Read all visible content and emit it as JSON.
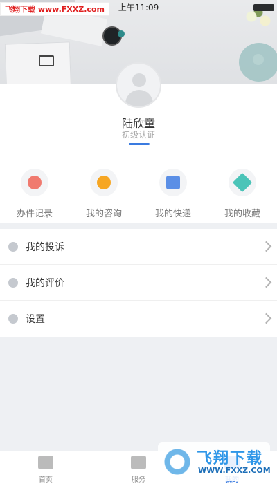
{
  "status_bar": {
    "time": "上午11:09"
  },
  "watermark": {
    "top_text": "飞翔下载 www.FXXZ.com",
    "bottom_title": "飞翔下载",
    "bottom_url": "WWW.FXXZ.COM"
  },
  "profile": {
    "name": "陆欣童",
    "level": "初级认证"
  },
  "quick_actions": [
    {
      "label": "办件记录",
      "icon": "clock-icon",
      "color": "#f07a6f"
    },
    {
      "label": "我的咨询",
      "icon": "chat-icon",
      "color": "#f6a623"
    },
    {
      "label": "我的快递",
      "icon": "wallet-icon",
      "color": "#5b8fe6"
    },
    {
      "label": "我的收藏",
      "icon": "star-icon",
      "color": "#4bc4b8"
    }
  ],
  "menu": [
    {
      "label": "我的投诉",
      "icon": "cube-icon"
    },
    {
      "label": "我的评价",
      "icon": "compass-icon"
    },
    {
      "label": "设置",
      "icon": "gear-icon"
    }
  ],
  "tabbar": [
    {
      "label": "首页",
      "icon": "home-icon",
      "active": false
    },
    {
      "label": "服务",
      "icon": "bookmark-icon",
      "active": false
    },
    {
      "label": "我的",
      "icon": "user-icon",
      "active": true
    }
  ],
  "colors": {
    "accent": "#3a7be0",
    "background": "#eef0f3"
  }
}
